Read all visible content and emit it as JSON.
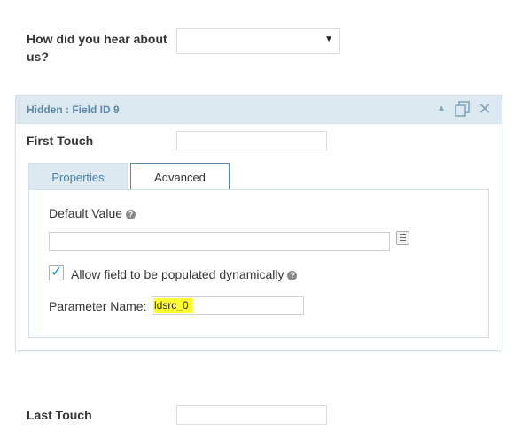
{
  "referral": {
    "label": "How did you hear about us?",
    "selected": ""
  },
  "field_panel": {
    "title": "Hidden : Field ID 9",
    "icons": [
      "collapse-icon",
      "duplicate-icon",
      "delete-icon"
    ]
  },
  "first_touch": {
    "label": "First Touch",
    "value": ""
  },
  "tabs": [
    {
      "label": "Properties"
    },
    {
      "label": "Advanced"
    }
  ],
  "advanced": {
    "default_value_label": "Default Value",
    "default_value": "",
    "allow_dynamic_label": "Allow field to be populated dynamically",
    "allow_dynamic_checked": true,
    "parameter_name_label": "Parameter Name:",
    "parameter_name_value": "ldsrc_0"
  },
  "last_touch": {
    "label": "Last Touch",
    "value": ""
  },
  "colors": {
    "panel_header_bg": "#dde9f0",
    "accent": "#5a8aa8",
    "highlight": "#ffff33",
    "checkmark": "#1e8cbe"
  }
}
